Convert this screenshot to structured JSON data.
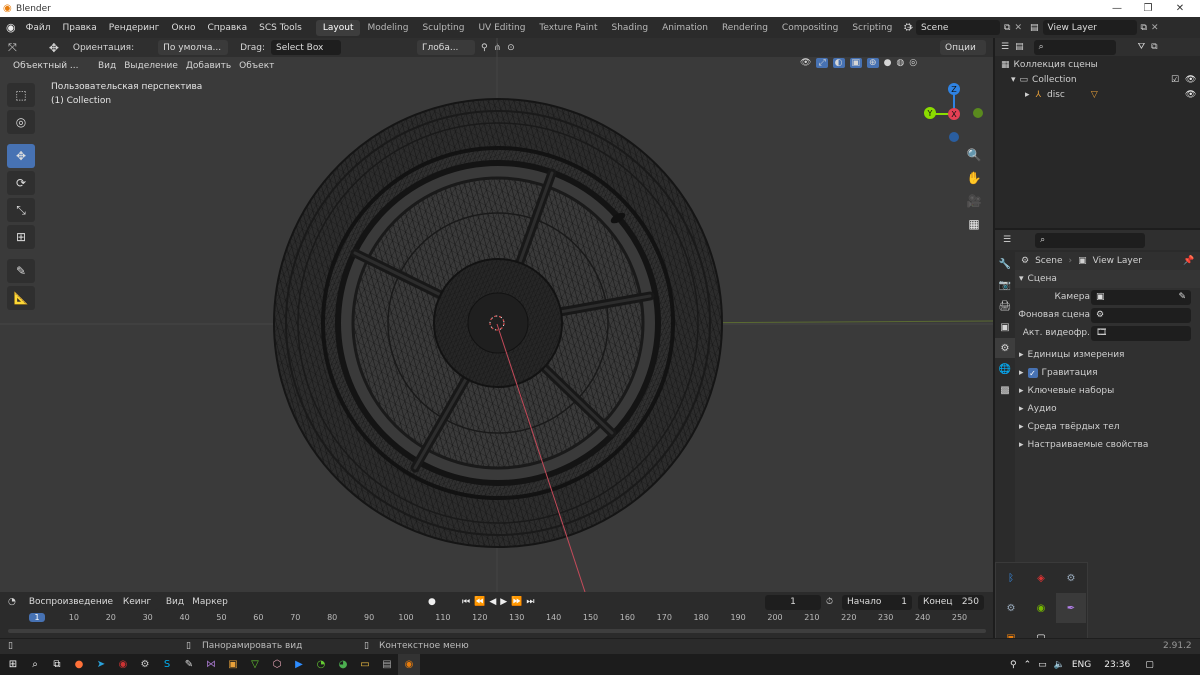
{
  "window": {
    "title": "Blender",
    "logo_icon": "blender-icon"
  },
  "menubar": {
    "menus": [
      "Файл",
      "Правка",
      "Рендеринг",
      "Окно",
      "Справка",
      "SCS Tools"
    ],
    "workspaces": [
      "Layout",
      "Modeling",
      "Sculpting",
      "UV Editing",
      "Texture Paint",
      "Shading",
      "Animation",
      "Rendering",
      "Compositing",
      "Scripting"
    ],
    "active_workspace": "Layout",
    "add_tab": "+",
    "scene_name": "Scene",
    "view_layer": "View Layer"
  },
  "viewport": {
    "orientation_label": "Ориентация:",
    "orientation_value": "По умолча...",
    "drag_label": "Drag:",
    "drag_value": "Select Box",
    "transform_value": "Глоба...",
    "options_label": "Опции",
    "mode": "Объектный ...",
    "menu": [
      "Вид",
      "Выделение",
      "Добавить",
      "Объект"
    ],
    "overlay_line1": "Пользовательская перспектива",
    "overlay_line2": "(1) Collection",
    "gizmo": {
      "x": "X",
      "y": "Y",
      "z": "Z"
    },
    "colors": {
      "x": "#e44054",
      "y": "#8bdc00",
      "z": "#2f83e3",
      "background": "#3a3a3a"
    }
  },
  "outliner": {
    "title": "Коллекция сцены",
    "items": [
      {
        "label": "Collection",
        "indent": 1
      },
      {
        "label": "disc",
        "indent": 2
      }
    ]
  },
  "properties": {
    "breadcrumb_scene": "Scene",
    "breadcrumb_layer": "View Layer",
    "section_title": "Сцена",
    "fields": [
      {
        "label": "Камера",
        "value": ""
      },
      {
        "label": "Фоновая сцена",
        "value": ""
      },
      {
        "label": "Акт. видеофр.",
        "value": ""
      }
    ],
    "panels": [
      "Единицы измерения",
      "Гравитация",
      "Ключевые наборы",
      "Аудио",
      "Среда твёрдых тел",
      "Настраиваемые свойства"
    ],
    "gravity_checked": true
  },
  "timeline": {
    "playback": "Воспроизведение",
    "keying": "Кеинг",
    "view": "Вид",
    "marker": "Маркер",
    "current_frame": "1",
    "start_label": "Начало",
    "start_value": "1",
    "end_label": "Конец",
    "end_value": "250",
    "ticks": [
      "1",
      "10",
      "20",
      "30",
      "40",
      "50",
      "60",
      "70",
      "80",
      "90",
      "100",
      "110",
      "120",
      "130",
      "140",
      "150",
      "160",
      "170",
      "180",
      "190",
      "200",
      "210",
      "220",
      "230",
      "240",
      "250"
    ]
  },
  "statusbar": {
    "hint_pan": "Панорамировать вид",
    "hint_context": "Контекстное меню",
    "version": "2.91.2"
  },
  "taskbar": {
    "language": "ENG",
    "time": "23:36"
  }
}
